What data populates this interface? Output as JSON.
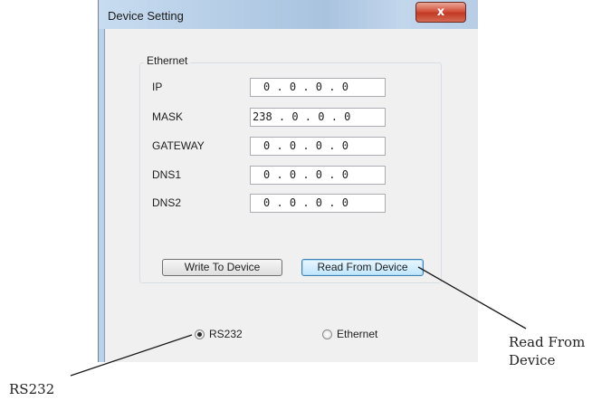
{
  "window": {
    "title": "Device Setting",
    "close_glyph": "x"
  },
  "ethernet": {
    "group_label": "Ethernet",
    "fields": [
      {
        "label": "IP",
        "value": "0 . 0 . 0 . 0"
      },
      {
        "label": "MASK",
        "value": "238 . 0 . 0 . 0"
      },
      {
        "label": "GATEWAY",
        "value": "0 . 0 . 0 . 0"
      },
      {
        "label": "DNS1",
        "value": "0 . 0 . 0 . 0"
      },
      {
        "label": "DNS2",
        "value": "0 . 0 . 0 . 0"
      }
    ]
  },
  "buttons": {
    "write": "Write To Device",
    "read": "Read From Device"
  },
  "connection": {
    "options": [
      {
        "label": "RS232",
        "selected": true
      },
      {
        "label": "Ethernet",
        "selected": false
      }
    ]
  },
  "callouts": {
    "read_line1": "Read From",
    "read_line2": "Device",
    "rs232": "RS232"
  },
  "colors": {
    "titlebar": "#b9d1ea",
    "client": "#f0f0f0",
    "close": "#c23a24",
    "default_button": "#bee6fd"
  }
}
